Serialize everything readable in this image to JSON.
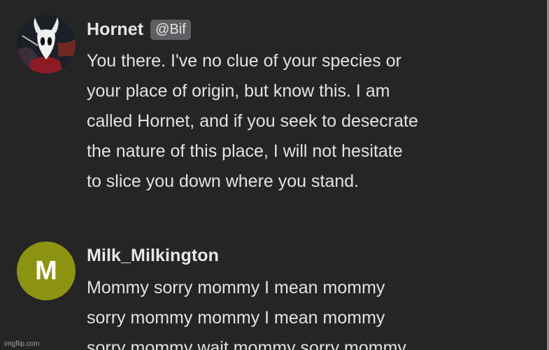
{
  "messages": [
    {
      "author": "Hornet",
      "handle": "@Bif",
      "avatar": {
        "icon": "hornet-character-icon",
        "colors": {
          "bg": "#1b1f26",
          "mask": "#f1f1f1",
          "cloak": "#8d1b24"
        }
      },
      "lines": [
        "You there. I've no clue of your species or",
        "your place of origin, but know this. I am",
        "called Hornet, and if you seek to desecrate",
        "the nature of this place, I will not hesitate",
        "to slice you down where you stand."
      ]
    },
    {
      "author": "Milk_Milkington",
      "avatar": {
        "letter": "M",
        "color": "#8c9311"
      },
      "lines": [
        "Mommy sorry mommy I mean mommy",
        "sorry mommy mommy I mean mommy",
        "sorry mommy wait mommy sorry mommy"
      ]
    }
  ],
  "watermark": "imgflip.com",
  "colors": {
    "background": "#252525",
    "text": "#e2e2e2",
    "badge": "#5d5f62"
  }
}
